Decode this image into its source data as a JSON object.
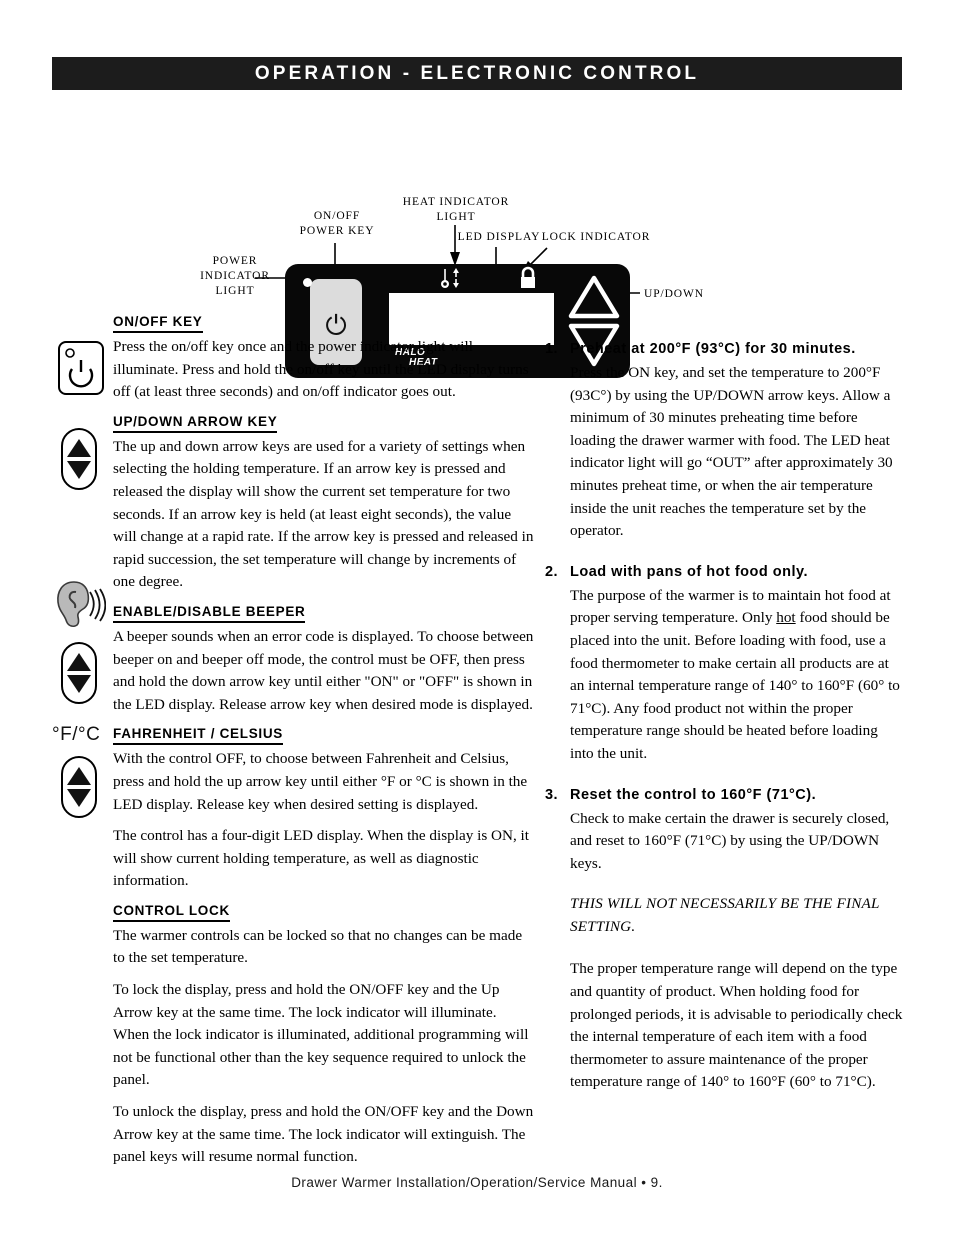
{
  "header": {
    "title": "OPERATION - ELECTRONIC CONTROL"
  },
  "diagram": {
    "callouts": {
      "power_indicator_light": "POWER\nINDICATOR\nLIGHT",
      "on_off_power_key": "ON/OFF\nPOWER KEY",
      "heat_indicator_light": "HEAT INDICATOR\nLIGHT",
      "led_display": "LED DISPLAY",
      "lock_indicator": "LOCK INDICATOR",
      "up_down": "UP/DOWN"
    },
    "panel": {
      "logo_line1": "HALO",
      "logo_line2": "HEAT",
      "display_value": "",
      "power_glyph": "power-symbol"
    }
  },
  "left_column": {
    "sections": [
      {
        "heading": "ON/OFF KEY",
        "icon": "power-key-icon",
        "paragraphs": [
          "Press the on/off key once and the power indicator light will illuminate.  Press and hold the on/off key until the LED display turns off (at least three seconds) and on/off indicator goes out."
        ]
      },
      {
        "heading": "UP/DOWN ARROW KEY",
        "icon": "up-down-arrow-key-icon",
        "paragraphs": [
          "The up and down arrow keys are used for a variety of settings when selecting the holding temperature.  If an arrow key is pressed and released the display will show the current set temperature for two seconds.  If an arrow key is held (at least eight seconds), the value will change at a rapid rate.  If the arrow key is pressed and released in rapid succession, the set temperature will change by increments of one degree."
        ]
      },
      {
        "heading": "ENABLE/DISABLE BEEPER",
        "icon": "ear-icon",
        "paragraphs": [
          "A beeper sounds when an error code is displayed.  To choose between beeper on and beeper off mode, the control must be OFF, then press and hold the down arrow key until either \"ON\" or \"OFF\" is shown in the LED display.  Release arrow key when desired mode is displayed."
        ]
      },
      {
        "heading": "FAHRENHEIT / CELSIUS",
        "icon": "fahrenheit-celsius-icon",
        "icon_label": "°F/°C",
        "paragraphs": [
          "With the control OFF, to choose between Fahrenheit and Celsius, press and hold the up arrow key until either °F or °C is shown in the LED display.  Release key when desired setting is displayed.",
          "The control has a four-digit LED display.  When the display is ON, it will show current holding temperature, as well as diagnostic information."
        ]
      },
      {
        "heading": "CONTROL LOCK",
        "icon": "",
        "paragraphs": [
          "The warmer controls can be locked so that no changes can be made to the set temperature.",
          "To lock the display, press and hold the ON/OFF key and the Up Arrow key at the same time.  The lock indicator will illuminate.  When the lock indicator is illuminated, additional programming will not be functional other than the key sequence required to unlock the panel.",
          "To unlock the display, press and hold the ON/OFF key and the Down Arrow key at the same time.  The lock indicator will extinguish.  The panel keys will resume normal function."
        ]
      }
    ]
  },
  "right_column": {
    "steps": [
      {
        "number": "1.",
        "title": "Preheat at 200°F (93°C) for 30 minutes.",
        "body_before_underline": "Press the ON key, and set the temperature to 200°F (93C°) by using the UP/DOWN arrow keys.  Allow a minimum of 30 minutes preheating time before loading the drawer warmer with food. The LED heat indicator light will go “OUT” after approximately 30 minutes preheat time, or when the air temperature inside the unit reaches the temperature set by the operator."
      },
      {
        "number": "2.",
        "title": "Load with pans of hot food only.",
        "body_part1": "The purpose of the warmer is to maintain hot food at proper serving temperature.  Only ",
        "body_underlined": "hot",
        "body_part2": " food should be placed into the unit.  Before loading with food, use a food thermometer to make certain all products are at an internal temperature range of 140° to 160°F (60° to 71°C).  Any food product not within the proper temperature range should be heated before loading into the unit."
      },
      {
        "number": "3.",
        "title": "Reset the control to 160°F (71°C).",
        "body_before_underline": "Check to make certain the drawer is securely closed, and reset to 160°F (71°C) by using the UP/DOWN keys."
      }
    ],
    "italic_note": "THIS WILL NOT NECESSARILY BE THE FINAL SETTING.",
    "closing_paragraph": "The proper temperature range will depend on the type and quantity of product.  When holding food for prolonged periods, it is advisable to periodically check the internal temperature of each item with a food thermometer to assure maintenance of the proper temperature range of 140° to 160°F (60° to 71°C)."
  },
  "footer": {
    "text": "Drawer Warmer Installation/Operation/Service Manual • 9."
  }
}
